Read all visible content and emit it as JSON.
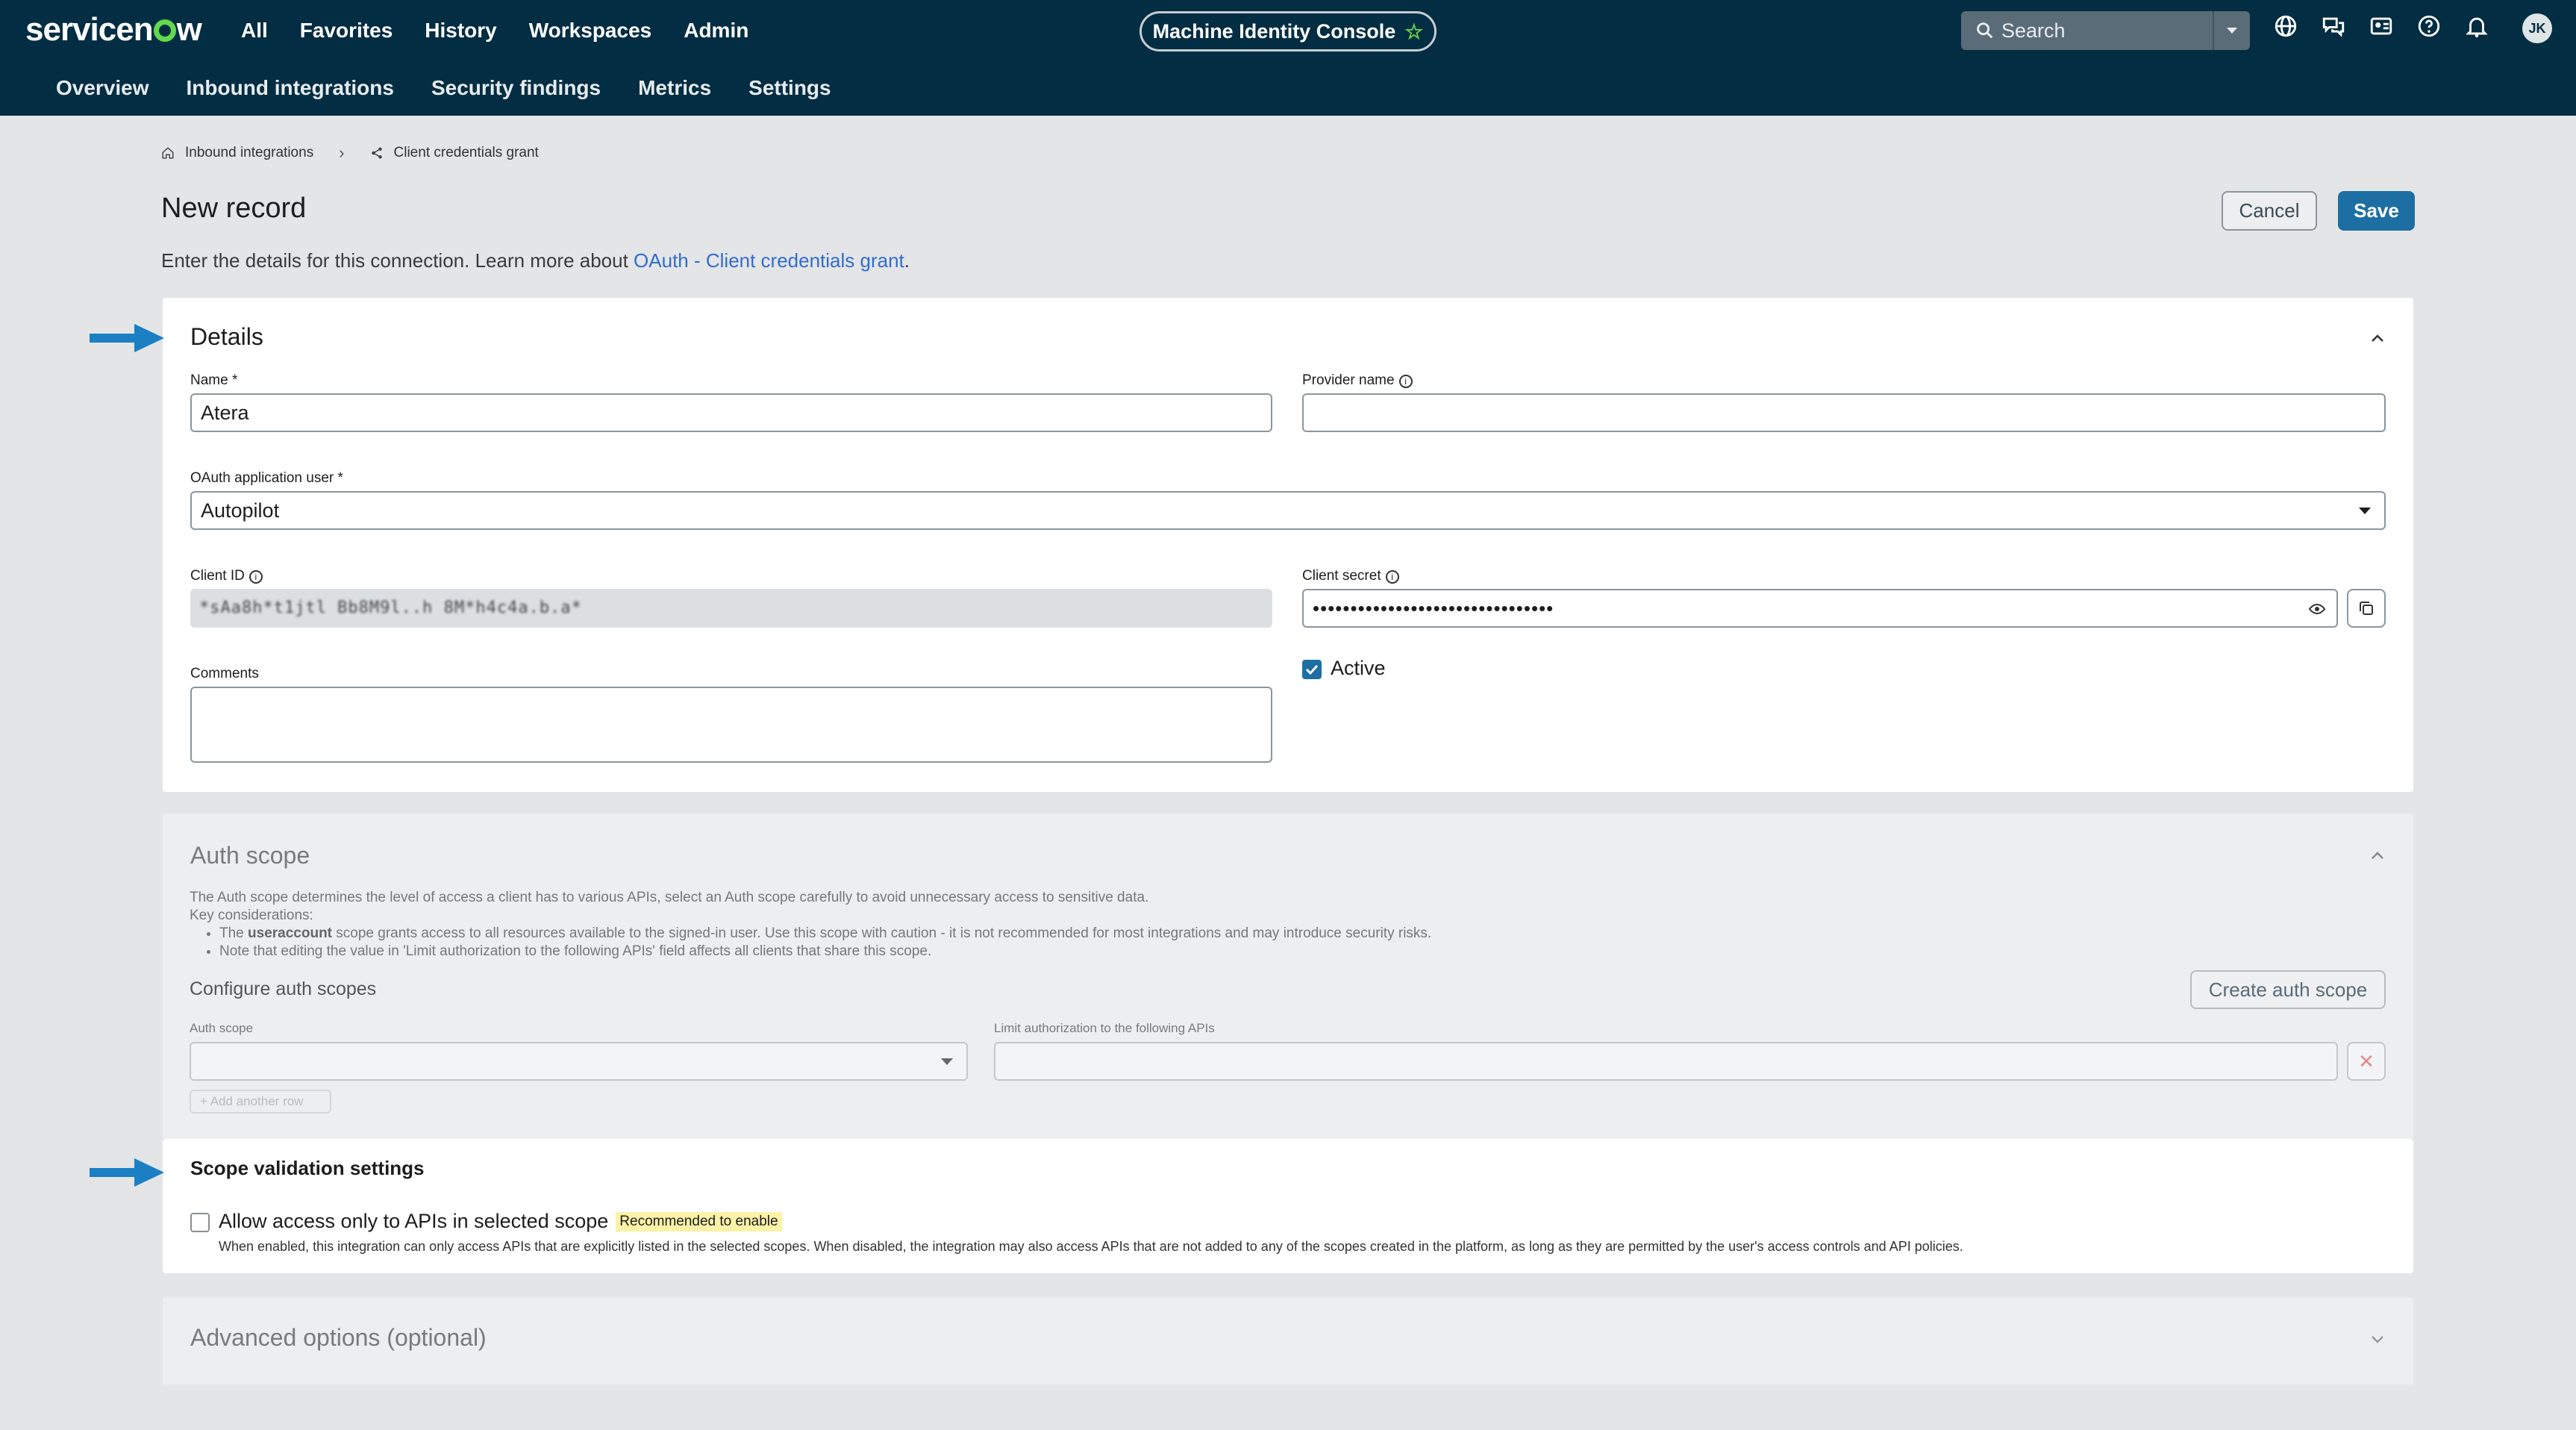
{
  "topnav": {
    "brand": "servicenow",
    "items": [
      "All",
      "Favorites",
      "History",
      "Workspaces",
      "Admin"
    ],
    "console_title": "Machine Identity Console",
    "search_placeholder": "Search",
    "avatar_initials": "JK"
  },
  "subnav": {
    "items": [
      "Overview",
      "Inbound integrations",
      "Security findings",
      "Metrics",
      "Settings"
    ]
  },
  "breadcrumb": {
    "items": [
      "Inbound integrations",
      "Client credentials grant"
    ]
  },
  "page": {
    "title": "New record",
    "intro_text": "Enter the details for this connection. Learn more about ",
    "intro_link": "OAuth - Client credentials grant",
    "intro_end": ".",
    "cancel_label": "Cancel",
    "save_label": "Save"
  },
  "details": {
    "title": "Details",
    "name_label": "Name",
    "name_value": "Atera",
    "provider_label": "Provider name",
    "provider_value": "",
    "oauth_user_label": "OAuth application user",
    "oauth_user_value": "Autopilot",
    "client_id_label": "Client ID",
    "client_id_value": "*sAa8h*t1jtl Bb8M9l..h  8M*h4c4a.b.a*",
    "client_secret_label": "Client secret",
    "client_secret_value": "••••••••••••••••••••••••••••••••",
    "comments_label": "Comments",
    "active_label": "Active",
    "active_checked": true
  },
  "auth_scope": {
    "title": "Auth scope",
    "description": "The Auth scope determines the level of access a client has to various APIs, select an Auth scope carefully to avoid unnecessary access to sensitive data.",
    "key_considerations": "Key considerations:",
    "bullet1_pre": "The ",
    "bullet1_bold": "useraccount",
    "bullet1_post": " scope grants access to all resources available to the signed-in user. Use this scope with caution - it is not recommended for most integrations and may introduce security risks.",
    "bullet2": "Note that editing the value in 'Limit authorization to the following APIs' field affects all clients that share this scope.",
    "configure_title": "Configure auth scopes",
    "create_button": "Create auth scope",
    "auth_scope_label": "Auth scope",
    "limit_label": "Limit authorization to the following APIs",
    "add_row": "+ Add another row"
  },
  "scope_validation": {
    "title": "Scope validation settings",
    "checkbox_label": "Allow access only to APIs in selected scope",
    "badge": "Recommended to enable",
    "help_text": "When enabled, this integration can only access APIs that are explicitly listed in the selected scopes. When disabled, the integration may also access APIs that are not added to any of the scopes created in the platform, as long as they are permitted by the user's access controls and API policies.",
    "checked": false
  },
  "advanced": {
    "title": "Advanced options (optional)"
  },
  "colors": {
    "header_bg": "#032d42",
    "accent": "#1d6fa3",
    "brand_green": "#62d84e",
    "arrow_blue": "#1b7fc4",
    "link": "#2f6dd0",
    "badge_bg": "#fbf2a8"
  }
}
